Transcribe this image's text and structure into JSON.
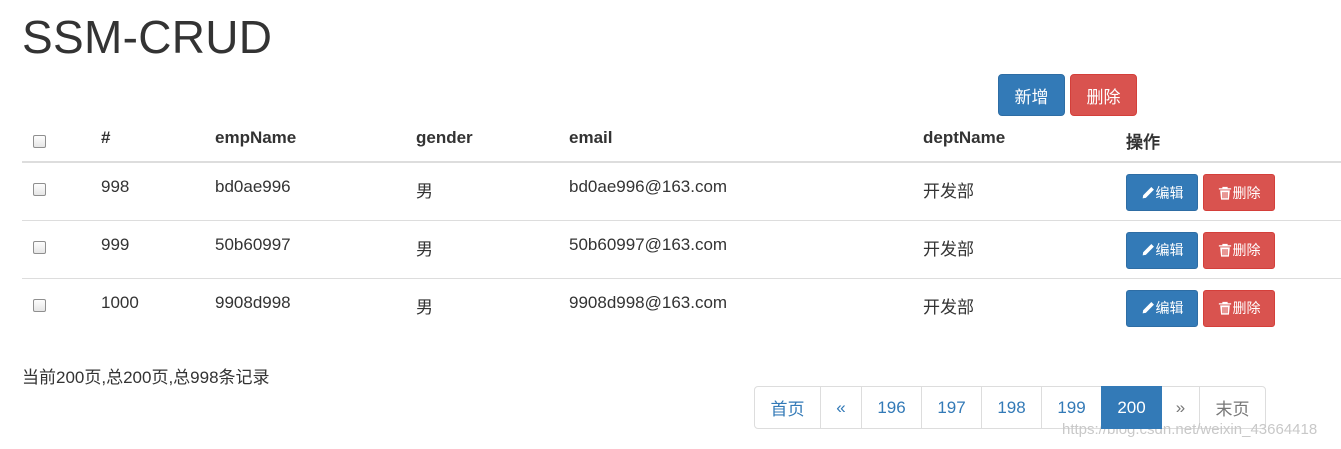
{
  "title": "SSM-CRUD",
  "toolbar": {
    "add_label": "新增",
    "delete_label": "删除"
  },
  "table": {
    "headers": [
      "#",
      "empName",
      "gender",
      "email",
      "deptName",
      "操作"
    ],
    "rows": [
      {
        "id": "998",
        "empName": "bd0ae996",
        "gender": "男",
        "email": "bd0ae996@163.com",
        "deptName": "开发部"
      },
      {
        "id": "999",
        "empName": "50b60997",
        "gender": "男",
        "email": "50b60997@163.com",
        "deptName": "开发部"
      },
      {
        "id": "1000",
        "empName": "9908d998",
        "gender": "男",
        "email": "9908d998@163.com",
        "deptName": "开发部"
      }
    ],
    "edit_label": "编辑",
    "delete_label": "删除"
  },
  "page_info": "当前200页,总200页,总998条记录",
  "pagination": {
    "first": "首页",
    "prev": "«",
    "pages": [
      "196",
      "197",
      "198",
      "199",
      "200"
    ],
    "active_page": "200",
    "next": "»",
    "last": "末页"
  },
  "watermark": "https://blog.csdn.net/weixin_43664418",
  "colors": {
    "primary": "#337ab7",
    "danger": "#d9534f",
    "border": "#dddddd"
  },
  "icons": {
    "edit": "pencil-icon",
    "delete": "trash-icon"
  }
}
